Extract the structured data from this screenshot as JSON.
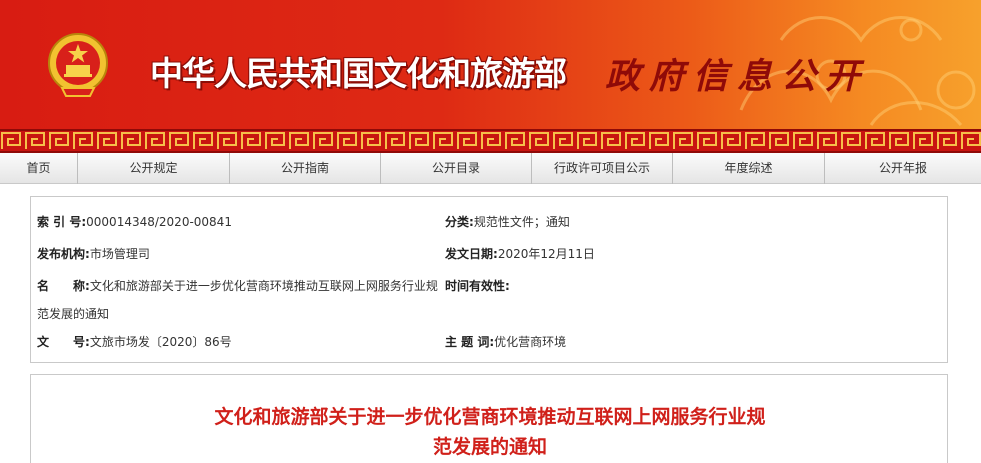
{
  "header": {
    "ministry_name": "中华人民共和国文化和旅游部",
    "section_title": "政府信息公开",
    "emblem_icon": "national-emblem-icon"
  },
  "colors": {
    "banner_red": "#d81c12",
    "banner_orange": "#f7a12c",
    "title_red": "#d0201a",
    "calligraphy_dark_red": "#8f0a08"
  },
  "nav": {
    "items": [
      "首页",
      "公开规定",
      "公开指南",
      "公开目录",
      "行政许可项目公示",
      "年度综述",
      "公开年报"
    ]
  },
  "info": {
    "index_label": "索 引 号:",
    "index_value": "000014348/2020-00841",
    "category_label": "分类:",
    "category_value": "规范性文件；通知",
    "issuer_label": "发布机构:",
    "issuer_value": "市场管理司",
    "date_label": "发文日期:",
    "date_value": "2020年12月11日",
    "name_label": "名　　称:",
    "name_value": "文化和旅游部关于进一步优化营商环境推动互联网上网服务行业规范发展的通知",
    "validity_label": "时间有效性:",
    "validity_value": "",
    "docno_label": "文　　号:",
    "docno_value": "文旅市场发〔2020〕86号",
    "subject_label": "主 题 词:",
    "subject_value": "优化营商环境"
  },
  "document": {
    "title_line1": "文化和旅游部关于进一步优化营商环境推动互联网上网服务行业规",
    "title_line2": "范发展的通知"
  }
}
